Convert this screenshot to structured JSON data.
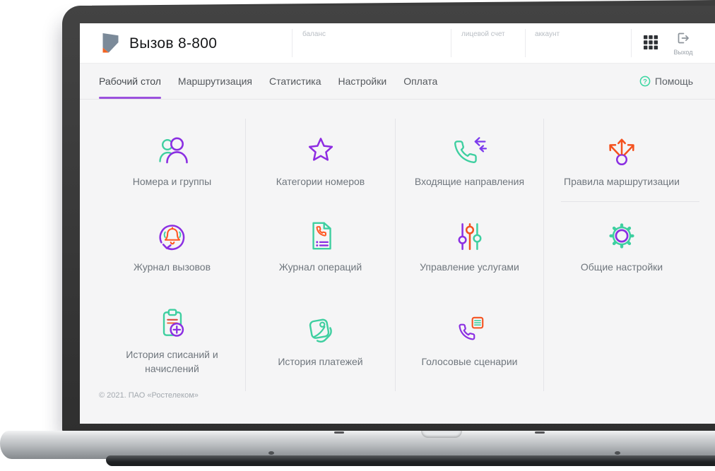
{
  "window": {
    "brand": "Вызов 8-800"
  },
  "header": {
    "account_fields": [
      {
        "label": "баланс"
      },
      {
        "label": "лицевой счет"
      },
      {
        "label": "аккаунт"
      }
    ],
    "logout": {
      "label": "Выход"
    }
  },
  "nav": {
    "tabs": [
      {
        "label": "Рабочий стол",
        "active": true
      },
      {
        "label": "Маршрутизация",
        "active": false
      },
      {
        "label": "Статистика",
        "active": false
      },
      {
        "label": "Настройки",
        "active": false
      },
      {
        "label": "Оплата",
        "active": false
      }
    ],
    "help": {
      "label": "Помощь"
    }
  },
  "dashboard": {
    "tiles": [
      {
        "label": "Номера и группы",
        "icon": "users-icon"
      },
      {
        "label": "Категории номеров",
        "icon": "star-icon"
      },
      {
        "label": "Входящие направления",
        "icon": "phone-incoming-icon"
      },
      {
        "label": "Правила маршрутизации",
        "icon": "route-split-icon"
      },
      {
        "label": "Журнал вызовов",
        "icon": "call-log-icon"
      },
      {
        "label": "Журнал операций",
        "icon": "operations-doc-icon"
      },
      {
        "label": "Управление услугами",
        "icon": "sliders-icon"
      },
      {
        "label": "Общие настройки",
        "icon": "gear-icon"
      },
      {
        "label": "История списаний и начислений",
        "icon": "clipboard-plus-icon"
      },
      {
        "label": "История платежей",
        "icon": "wallet-icon"
      },
      {
        "label": "Голосовые сценарии",
        "icon": "voice-script-icon"
      }
    ]
  },
  "footer": {
    "copyright": "© 2021. ПАО «Ростелеком»"
  },
  "colors": {
    "accent_purple": "#8b2fe2",
    "accent_teal": "#3ecfa0",
    "accent_orange": "#f4511e",
    "tab_underline": "#9b51dd",
    "help_green": "#38d6a0",
    "logo_slate": "#7b8a99",
    "logo_orange": "#f26322"
  }
}
